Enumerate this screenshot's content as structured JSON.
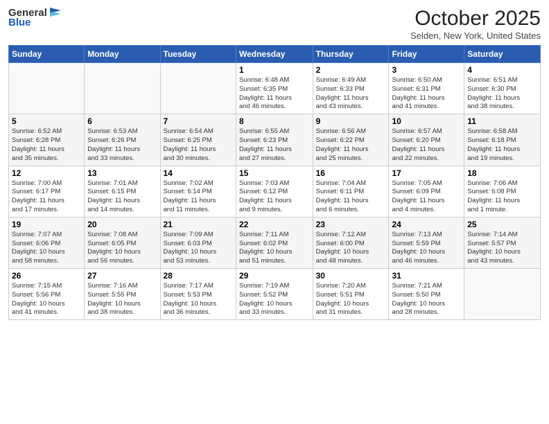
{
  "header": {
    "logo_line1": "General",
    "logo_line2": "Blue",
    "month": "October 2025",
    "location": "Selden, New York, United States"
  },
  "days_of_week": [
    "Sunday",
    "Monday",
    "Tuesday",
    "Wednesday",
    "Thursday",
    "Friday",
    "Saturday"
  ],
  "weeks": [
    [
      {
        "day": "",
        "info": ""
      },
      {
        "day": "",
        "info": ""
      },
      {
        "day": "",
        "info": ""
      },
      {
        "day": "1",
        "info": "Sunrise: 6:48 AM\nSunset: 6:35 PM\nDaylight: 11 hours\nand 46 minutes."
      },
      {
        "day": "2",
        "info": "Sunrise: 6:49 AM\nSunset: 6:33 PM\nDaylight: 11 hours\nand 43 minutes."
      },
      {
        "day": "3",
        "info": "Sunrise: 6:50 AM\nSunset: 6:31 PM\nDaylight: 11 hours\nand 41 minutes."
      },
      {
        "day": "4",
        "info": "Sunrise: 6:51 AM\nSunset: 6:30 PM\nDaylight: 11 hours\nand 38 minutes."
      }
    ],
    [
      {
        "day": "5",
        "info": "Sunrise: 6:52 AM\nSunset: 6:28 PM\nDaylight: 11 hours\nand 35 minutes."
      },
      {
        "day": "6",
        "info": "Sunrise: 6:53 AM\nSunset: 6:26 PM\nDaylight: 11 hours\nand 33 minutes."
      },
      {
        "day": "7",
        "info": "Sunrise: 6:54 AM\nSunset: 6:25 PM\nDaylight: 11 hours\nand 30 minutes."
      },
      {
        "day": "8",
        "info": "Sunrise: 6:55 AM\nSunset: 6:23 PM\nDaylight: 11 hours\nand 27 minutes."
      },
      {
        "day": "9",
        "info": "Sunrise: 6:56 AM\nSunset: 6:22 PM\nDaylight: 11 hours\nand 25 minutes."
      },
      {
        "day": "10",
        "info": "Sunrise: 6:57 AM\nSunset: 6:20 PM\nDaylight: 11 hours\nand 22 minutes."
      },
      {
        "day": "11",
        "info": "Sunrise: 6:58 AM\nSunset: 6:18 PM\nDaylight: 11 hours\nand 19 minutes."
      }
    ],
    [
      {
        "day": "12",
        "info": "Sunrise: 7:00 AM\nSunset: 6:17 PM\nDaylight: 11 hours\nand 17 minutes."
      },
      {
        "day": "13",
        "info": "Sunrise: 7:01 AM\nSunset: 6:15 PM\nDaylight: 11 hours\nand 14 minutes."
      },
      {
        "day": "14",
        "info": "Sunrise: 7:02 AM\nSunset: 6:14 PM\nDaylight: 11 hours\nand 11 minutes."
      },
      {
        "day": "15",
        "info": "Sunrise: 7:03 AM\nSunset: 6:12 PM\nDaylight: 11 hours\nand 9 minutes."
      },
      {
        "day": "16",
        "info": "Sunrise: 7:04 AM\nSunset: 6:11 PM\nDaylight: 11 hours\nand 6 minutes."
      },
      {
        "day": "17",
        "info": "Sunrise: 7:05 AM\nSunset: 6:09 PM\nDaylight: 11 hours\nand 4 minutes."
      },
      {
        "day": "18",
        "info": "Sunrise: 7:06 AM\nSunset: 6:08 PM\nDaylight: 11 hours\nand 1 minute."
      }
    ],
    [
      {
        "day": "19",
        "info": "Sunrise: 7:07 AM\nSunset: 6:06 PM\nDaylight: 10 hours\nand 58 minutes."
      },
      {
        "day": "20",
        "info": "Sunrise: 7:08 AM\nSunset: 6:05 PM\nDaylight: 10 hours\nand 56 minutes."
      },
      {
        "day": "21",
        "info": "Sunrise: 7:09 AM\nSunset: 6:03 PM\nDaylight: 10 hours\nand 53 minutes."
      },
      {
        "day": "22",
        "info": "Sunrise: 7:11 AM\nSunset: 6:02 PM\nDaylight: 10 hours\nand 51 minutes."
      },
      {
        "day": "23",
        "info": "Sunrise: 7:12 AM\nSunset: 6:00 PM\nDaylight: 10 hours\nand 48 minutes."
      },
      {
        "day": "24",
        "info": "Sunrise: 7:13 AM\nSunset: 5:59 PM\nDaylight: 10 hours\nand 46 minutes."
      },
      {
        "day": "25",
        "info": "Sunrise: 7:14 AM\nSunset: 5:57 PM\nDaylight: 10 hours\nand 43 minutes."
      }
    ],
    [
      {
        "day": "26",
        "info": "Sunrise: 7:15 AM\nSunset: 5:56 PM\nDaylight: 10 hours\nand 41 minutes."
      },
      {
        "day": "27",
        "info": "Sunrise: 7:16 AM\nSunset: 5:55 PM\nDaylight: 10 hours\nand 38 minutes."
      },
      {
        "day": "28",
        "info": "Sunrise: 7:17 AM\nSunset: 5:53 PM\nDaylight: 10 hours\nand 36 minutes."
      },
      {
        "day": "29",
        "info": "Sunrise: 7:19 AM\nSunset: 5:52 PM\nDaylight: 10 hours\nand 33 minutes."
      },
      {
        "day": "30",
        "info": "Sunrise: 7:20 AM\nSunset: 5:51 PM\nDaylight: 10 hours\nand 31 minutes."
      },
      {
        "day": "31",
        "info": "Sunrise: 7:21 AM\nSunset: 5:50 PM\nDaylight: 10 hours\nand 28 minutes."
      },
      {
        "day": "",
        "info": ""
      }
    ]
  ]
}
